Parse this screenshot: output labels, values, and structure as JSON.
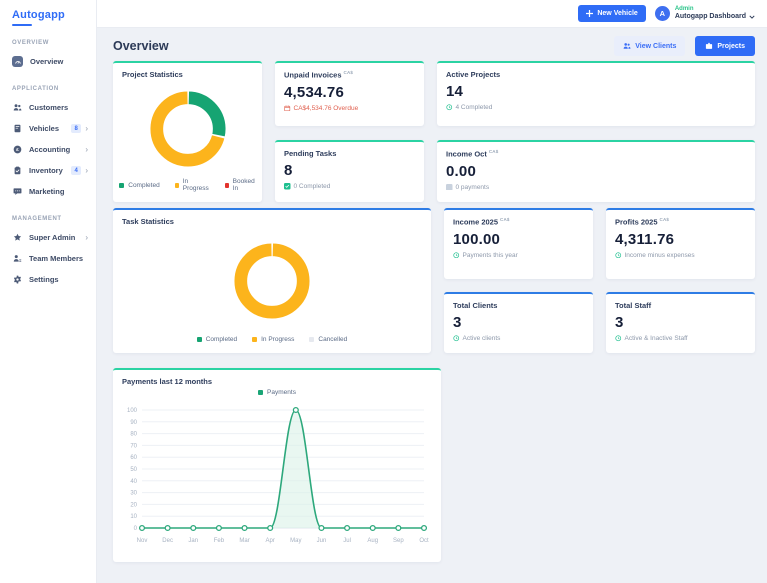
{
  "brand": {
    "logo": "Autogapp"
  },
  "sidebar": {
    "sections": [
      {
        "label": "OVERVIEW",
        "items": [
          {
            "label": "Overview",
            "active": true
          }
        ]
      },
      {
        "label": "APPLICATION",
        "items": [
          {
            "label": "Customers"
          },
          {
            "label": "Vehicles",
            "badge": "8",
            "chevron": "›"
          },
          {
            "label": "Accounting",
            "chevron": "›"
          },
          {
            "label": "Inventory",
            "badge": "4",
            "chevron": "›"
          },
          {
            "label": "Marketing"
          }
        ]
      },
      {
        "label": "MANAGEMENT",
        "items": [
          {
            "label": "Super Admin",
            "chevron": "›"
          },
          {
            "label": "Team Members"
          },
          {
            "label": "Settings"
          }
        ]
      }
    ]
  },
  "topbar": {
    "new_vehicle_label": "New Vehicle",
    "user": {
      "initial": "A",
      "role": "Admin",
      "name": "Autogapp Dashboard"
    }
  },
  "header": {
    "title": "Overview",
    "view_clients_label": "View Clients",
    "projects_label": "Projects"
  },
  "cards": {
    "unpaid_invoices": {
      "title": "Unpaid Invoices",
      "currency": "CA$",
      "value": "4,534.76",
      "note": "CA$4,534.76 Overdue"
    },
    "active_projects": {
      "title": "Active Projects",
      "value": "14",
      "note": "4 Completed"
    },
    "pending_tasks": {
      "title": "Pending Tasks",
      "value": "8",
      "note": "0 Completed"
    },
    "income_oct": {
      "title": "Income Oct",
      "currency": "CA$",
      "value": "0.00",
      "note": "0 payments"
    },
    "project_statistics": {
      "title": "Project Statistics"
    },
    "task_statistics": {
      "title": "Task Statistics"
    },
    "income_2025": {
      "title": "Income 2025",
      "currency": "CA$",
      "value": "100.00",
      "note": "Payments this year"
    },
    "profits_2025": {
      "title": "Profits 2025",
      "currency": "CA$",
      "value": "4,311.76",
      "note": "Income minus expenses"
    },
    "total_clients": {
      "title": "Total Clients",
      "value": "3",
      "note": "Active clients"
    },
    "total_staff": {
      "title": "Total Staff",
      "value": "3",
      "note": "Active & Inactive Staff"
    },
    "payments_chart": {
      "title": "Payments last 12 months"
    }
  },
  "colors": {
    "accent_blue": "#2f6cf6",
    "teal_border": "#2bd3a3",
    "blue_border": "#2e7ce5",
    "green": "#1aa576",
    "yellow": "#fcb41c",
    "red": "#e2342d"
  },
  "chart_data": [
    {
      "id": "project_statistics",
      "type": "pie",
      "variant": "donut",
      "title": "Project Statistics",
      "labels": [
        "Completed",
        "In Progress",
        "Booked In"
      ],
      "values": [
        4,
        10,
        0
      ],
      "colors": [
        "#16a472",
        "#fcb41c",
        "#e2342d"
      ],
      "legend_position": "bottom"
    },
    {
      "id": "task_statistics",
      "type": "pie",
      "variant": "donut",
      "title": "Task Statistics",
      "labels": [
        "Completed",
        "In Progress",
        "Cancelled"
      ],
      "values": [
        0,
        8,
        0
      ],
      "colors": [
        "#16a472",
        "#fcb41c",
        "#e6e9ef"
      ],
      "legend_position": "bottom"
    },
    {
      "id": "payments_12m",
      "type": "area",
      "title": "Payments last 12 months",
      "x": [
        "Nov",
        "Dec",
        "Jan",
        "Feb",
        "Mar",
        "Apr",
        "May",
        "Jun",
        "Jul",
        "Aug",
        "Sep",
        "Oct"
      ],
      "series": [
        {
          "name": "Payments",
          "values": [
            0,
            0,
            0,
            0,
            0,
            0,
            100,
            0,
            0,
            0,
            0,
            0
          ]
        }
      ],
      "ylim": [
        0,
        100
      ],
      "ytick_step": 10,
      "grid": true,
      "line_color": "#2da87c",
      "fill_color": "#daf2e7",
      "legend_color": "#1aa576",
      "legend_position": "top"
    }
  ]
}
